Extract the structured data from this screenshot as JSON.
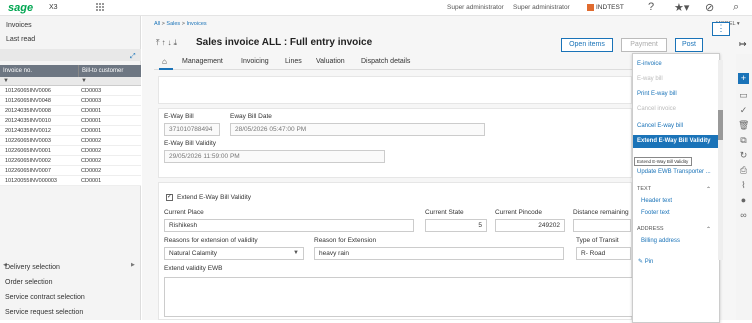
{
  "app": {
    "logo": "sage",
    "product": "X3"
  },
  "topbar": {
    "user1": "Super administrator",
    "user2": "Super administrator",
    "folder": "INDTEST"
  },
  "left": {
    "items": [
      "Invoices",
      "Last read"
    ],
    "columns": [
      "Invoice no.",
      "Bill-to customer"
    ],
    "filter": "▼",
    "rows": [
      [
        "10126065INV0006",
        "CD0003"
      ],
      [
        "10126065INV0048",
        "CD0003"
      ],
      [
        "20124035INV0008",
        "CD0001"
      ],
      [
        "20124035INV0010",
        "CD0001"
      ],
      [
        "20124035INV0012",
        "CD0001"
      ],
      [
        "10226065INV0003",
        "CD0002"
      ],
      [
        "10226065INV0001",
        "CD0002"
      ],
      [
        "10226065INV0002",
        "CD0002"
      ],
      [
        "10226065INV0007",
        "CD0002"
      ],
      [
        "10120055INV000003",
        "CD0001"
      ]
    ],
    "bottom": [
      "Delivery selection",
      "Order selection",
      "Service contract selection",
      "Service request selection"
    ]
  },
  "breadcrumb": {
    "a": "All",
    "b": "Sales",
    "c": "Invoices"
  },
  "model_label": "MODEL",
  "header": {
    "title": "Sales invoice ALL : Full entry invoice",
    "open_items": "Open items",
    "payment": "Payment",
    "post": "Post"
  },
  "tabs": [
    "Management",
    "Invoicing",
    "Lines",
    "Valuation",
    "Dispatch details"
  ],
  "form": {
    "eway_bill_label": "E-Way Bill",
    "eway_bill_value": "371010788494",
    "eway_date_label": "Eway Bill Date",
    "eway_date_value": "28/05/2026 05:47:00 PM",
    "validity_label": "E-Way Bill Validity",
    "validity_value": "29/05/2026 11:59:00 PM",
    "extend_label": "Extend E-Way Bill Validity",
    "current_place_label": "Current Place",
    "current_place_value": "Rishikesh",
    "current_state_label": "Current State",
    "current_state_value": "5",
    "current_pincode_label": "Current Pincode",
    "current_pincode_value": "249202",
    "distance_label": "Distance remaining",
    "reason_ext_label": "Reasons for extension of validity",
    "reason_ext_value": "Natural Calamity",
    "reason_label": "Reason for Extension",
    "reason_value": "heavy rain",
    "transit_label": "Type of Transit",
    "transit_value": "R- Road",
    "extend_ewb_label": "Extend validity EWB"
  },
  "menu": {
    "items": [
      {
        "label": "E-invoice",
        "state": "normal"
      },
      {
        "label": "E-way bill",
        "state": "disabled"
      },
      {
        "label": "Print E-way bill",
        "state": "normal"
      },
      {
        "label": "Cancel invoice",
        "state": "disabled"
      },
      {
        "label": "Cancel E-way bill",
        "state": "normal"
      },
      {
        "label": "Extend E-Way Bill Validity",
        "state": "selected"
      },
      {
        "label": "Update EWB Transporter ...",
        "state": "normal"
      }
    ],
    "text_section": "TEXT",
    "text_items": [
      "Header text",
      "Footer text"
    ],
    "address_section": "ADDRESS",
    "address_items": [
      "Billing address"
    ],
    "pin": "Pin",
    "tooltip": "Extend E-Way Bill Validity"
  }
}
